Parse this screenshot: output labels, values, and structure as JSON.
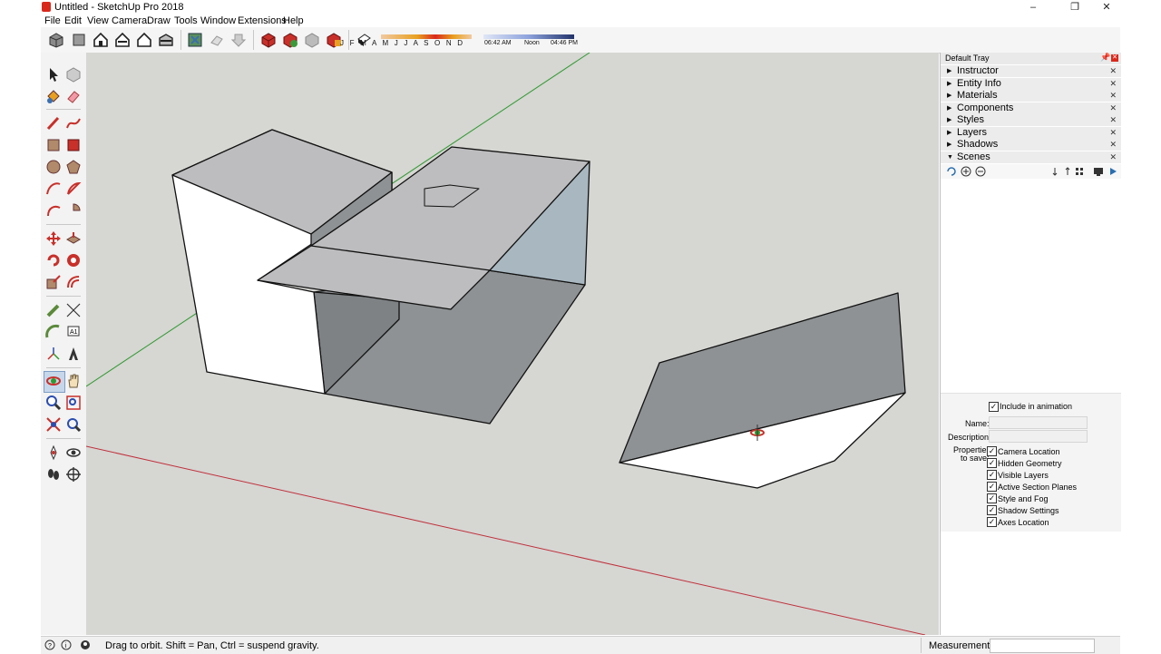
{
  "window": {
    "title": "Untitled - SketchUp Pro 2018",
    "minimize_glyph": "–",
    "restore_glyph": "❐",
    "close_glyph": "✕"
  },
  "menu": [
    "File",
    "Edit",
    "View",
    "Camera",
    "Draw",
    "Tools",
    "Window",
    "Extensions",
    "Help"
  ],
  "toolbar": {
    "icons": [
      "iso-view-icon",
      "top-view-icon",
      "front-view-icon",
      "right-view-icon",
      "back-view-icon",
      "left-view-icon",
      "geo-location-icon",
      "add-location-icon",
      "photo-textures-icon",
      "3d-warehouse-icon",
      "share-model-icon",
      "extension-warehouse-icon",
      "extension-manager-icon",
      "shadows-toggle-icon"
    ],
    "shadow_months": "J F M A M J J A S O N D",
    "time_start": "06:42 AM",
    "time_noon": "Noon",
    "time_end": "04:46 PM"
  },
  "left_tools": [
    "select-icon",
    "make-component-icon",
    "paint-bucket-icon",
    "eraser-icon",
    "line-icon",
    "freehand-icon",
    "rectangle-icon",
    "rotated-rectangle-icon",
    "circle-icon",
    "polygon-icon",
    "arc-icon",
    "two-point-arc-icon",
    "three-point-arc-icon",
    "pie-icon",
    "move-icon",
    "push-pull-icon",
    "rotate-icon",
    "follow-me-icon",
    "scale-icon",
    "offset-icon",
    "tape-measure-icon",
    "dimension-icon",
    "protractor-icon",
    "text-icon",
    "axes-icon",
    "3d-text-icon",
    "orbit-icon",
    "pan-icon",
    "zoom-icon",
    "zoom-window-icon",
    "zoom-extents-icon",
    "previous-view-icon",
    "position-camera-icon",
    "look-around-icon",
    "walk-icon",
    "section-plane-icon"
  ],
  "tray": {
    "title": "Default Tray",
    "panels": [
      {
        "label": "Instructor",
        "expanded": false
      },
      {
        "label": "Entity Info",
        "expanded": false
      },
      {
        "label": "Materials",
        "expanded": false
      },
      {
        "label": "Components",
        "expanded": false
      },
      {
        "label": "Styles",
        "expanded": false
      },
      {
        "label": "Layers",
        "expanded": false
      },
      {
        "label": "Shadows",
        "expanded": false
      },
      {
        "label": "Scenes",
        "expanded": true
      }
    ],
    "scenes": {
      "include_in_animation": "Include in animation",
      "name_label": "Name:",
      "name_value": "",
      "description_label": "Description:",
      "description_value": "",
      "properties_label_1": "Properties",
      "properties_label_2": "to save:",
      "properties": [
        "Camera Location",
        "Hidden Geometry",
        "Visible Layers",
        "Active Section Planes",
        "Style and Fog",
        "Shadow Settings",
        "Axes Location"
      ]
    }
  },
  "status": {
    "hint": "Drag to orbit. Shift = Pan, Ctrl = suspend gravity.",
    "measurements_label": "Measurements",
    "measurements_value": ""
  },
  "colors": {
    "viewport_bg": "#d6d6d3",
    "face_light": "#ffffff",
    "face_gray": "#bdbdbf",
    "face_dark": "#8f9294",
    "face_back": "#a8b7c0",
    "axis_red": "#c0303a",
    "axis_green": "#2f9a2f"
  }
}
